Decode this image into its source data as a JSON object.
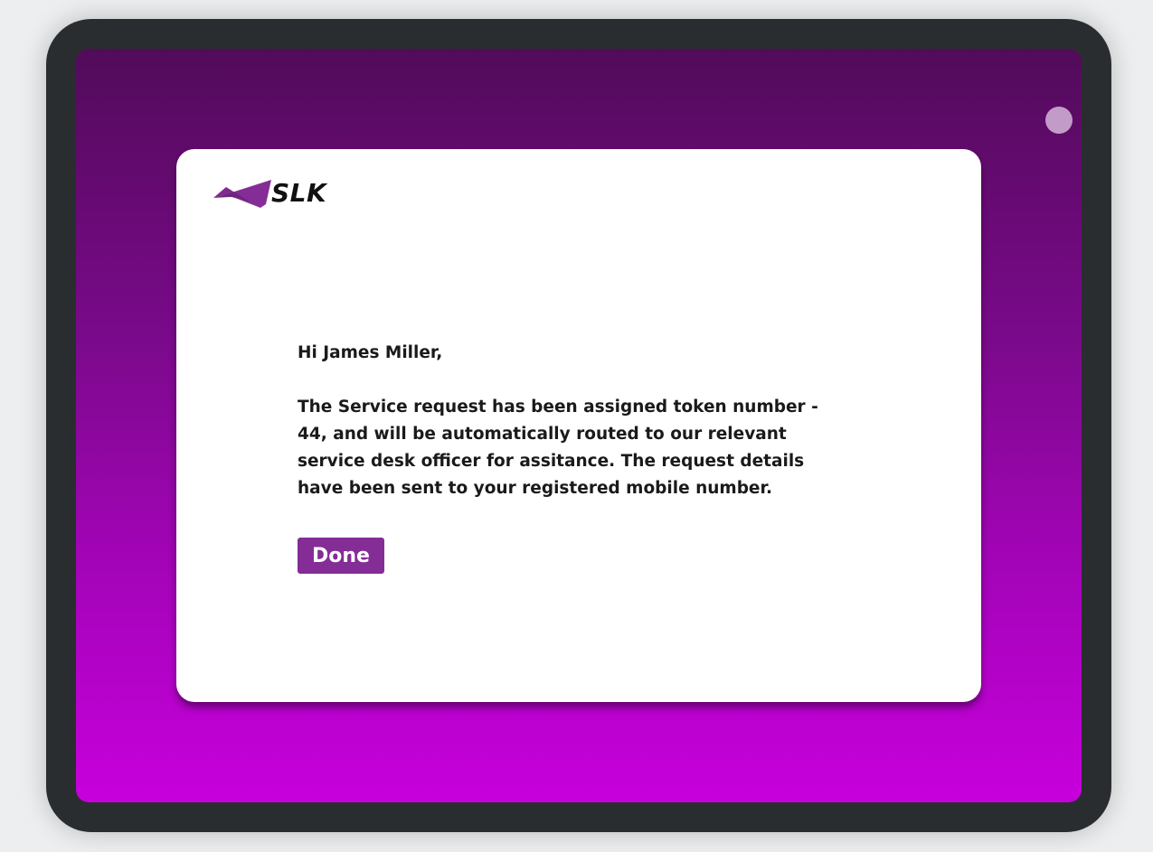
{
  "brand": {
    "logo_text": "SLK",
    "logo_icon": "slk-wing-logo",
    "accent_color": "#842d96"
  },
  "dialog": {
    "greeting": "Hi James Miller,",
    "message": "The Service request has been assigned token number - 44, and will be automatically routed to our relevant service desk officer for assitance. The request details have been sent to your registered mobile number.",
    "done_label": "Done"
  },
  "colors": {
    "background_top": "#520b5a",
    "background_bottom": "#c700dc",
    "frame": "#2a2d30",
    "camera": "#c39bc8"
  }
}
